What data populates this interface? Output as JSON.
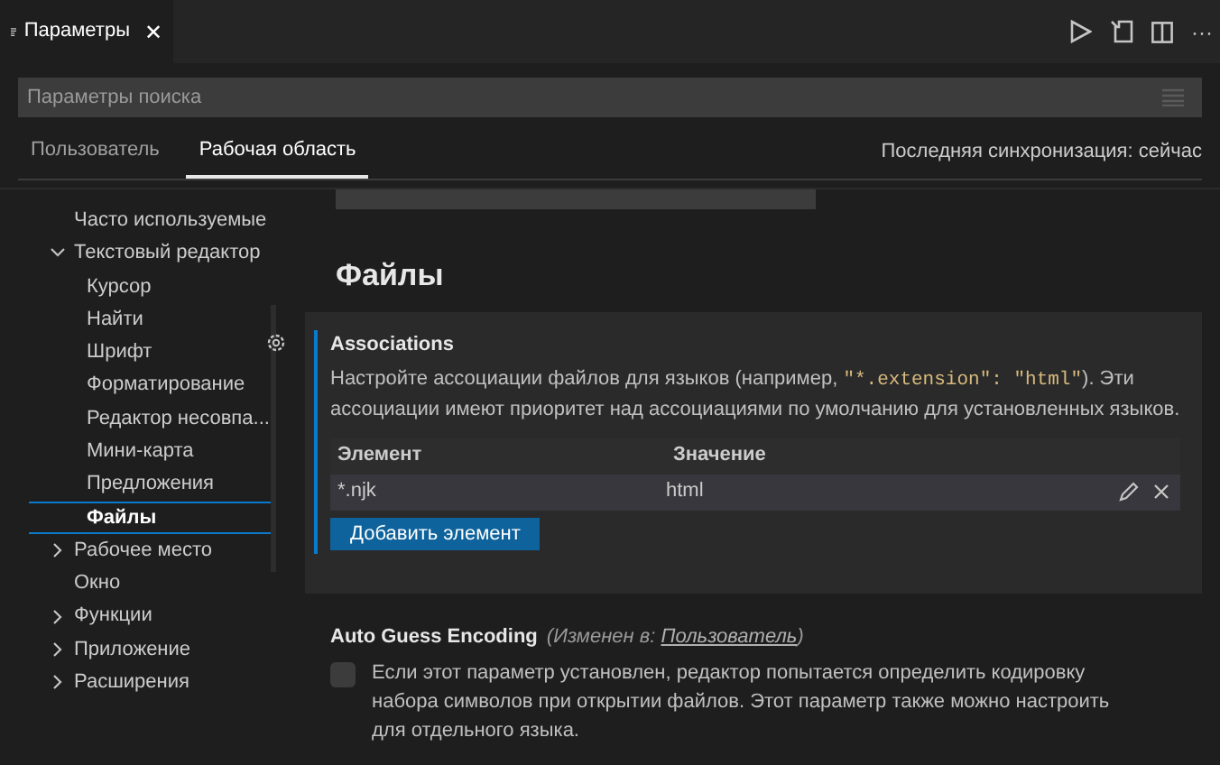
{
  "editor_tab": {
    "title": "Параметры",
    "close": "✕"
  },
  "toolbar": {
    "more": "···"
  },
  "search": {
    "placeholder": "Параметры поиска"
  },
  "scope_tabs": [
    {
      "label": "Пользователь",
      "selected": false
    },
    {
      "label": "Рабочая область",
      "selected": true
    }
  ],
  "sync_status": "Последняя синхронизация: сейчас",
  "tree": [
    {
      "label": "Часто используемые",
      "selected": false
    },
    {
      "label": "Текстовый редактор",
      "expanded": true,
      "selected": false,
      "children": [
        {
          "label": "Курсор",
          "selected": false
        },
        {
          "label": "Найти",
          "selected": false
        },
        {
          "label": "Шрифт",
          "selected": false
        },
        {
          "label": "Форматирование",
          "selected": false
        },
        {
          "label": "Редактор несовпа...",
          "selected": false
        },
        {
          "label": "Мини-карта",
          "selected": false
        },
        {
          "label": "Предложения",
          "selected": false
        },
        {
          "label": "Файлы",
          "selected": true
        }
      ]
    },
    {
      "label": "Рабочее место",
      "expanded": false,
      "selected": false
    },
    {
      "label": "Окно",
      "selected": false
    },
    {
      "label": "Функции",
      "expanded": false,
      "selected": false
    },
    {
      "label": "Приложение",
      "expanded": false,
      "selected": false
    },
    {
      "label": "Расширения",
      "expanded": false,
      "selected": false
    }
  ],
  "section_title": "Файлы",
  "settings": [
    {
      "kind": "map",
      "focused": true,
      "title": "Associations",
      "description": [
        {
          "kind": "text",
          "text": "Настройте ассоциации файлов для языков (например, "
        },
        {
          "kind": "code",
          "text": "\"*.extension\": \"html\""
        },
        {
          "kind": "text",
          "text": "). Эти ассоциации имеют приоритет над ассоциациями по умолчанию для установленных языков."
        }
      ],
      "columns": [
        "Элемент",
        "Значение"
      ],
      "rows": [
        {
          "key": "*.njk",
          "value": "html"
        }
      ],
      "add_button": "Добавить элемент"
    },
    {
      "kind": "checkbox",
      "focused": false,
      "title": "Auto Guess Encoding",
      "modified_prefix": "(Изменен в: ",
      "modified_link": "Пользователь",
      "modified_suffix": ")",
      "checked": false,
      "description": [
        {
          "kind": "text",
          "text": "Если этот параметр установлен, редактор попытается определить кодировку набора символов при открытии файлов. Этот параметр также можно настроить для отдельного языка."
        }
      ]
    }
  ]
}
